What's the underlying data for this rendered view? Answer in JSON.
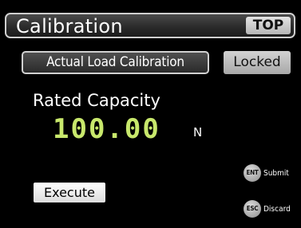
{
  "header": {
    "title": "Calibration",
    "top_button": "TOP"
  },
  "mode": {
    "button_label": "Actual Load Calibration",
    "lock_status": "Locked"
  },
  "rated_capacity": {
    "label": "Rated Capacity",
    "value": "100.00",
    "unit": "N"
  },
  "actions": {
    "execute_label": "Execute"
  },
  "key_hints": {
    "enter": {
      "key": "ENT",
      "label": "Submit"
    },
    "escape": {
      "key": "ESC",
      "label": "Discard"
    }
  },
  "colors": {
    "value_accent": "#c8e86c",
    "background": "#000000"
  }
}
